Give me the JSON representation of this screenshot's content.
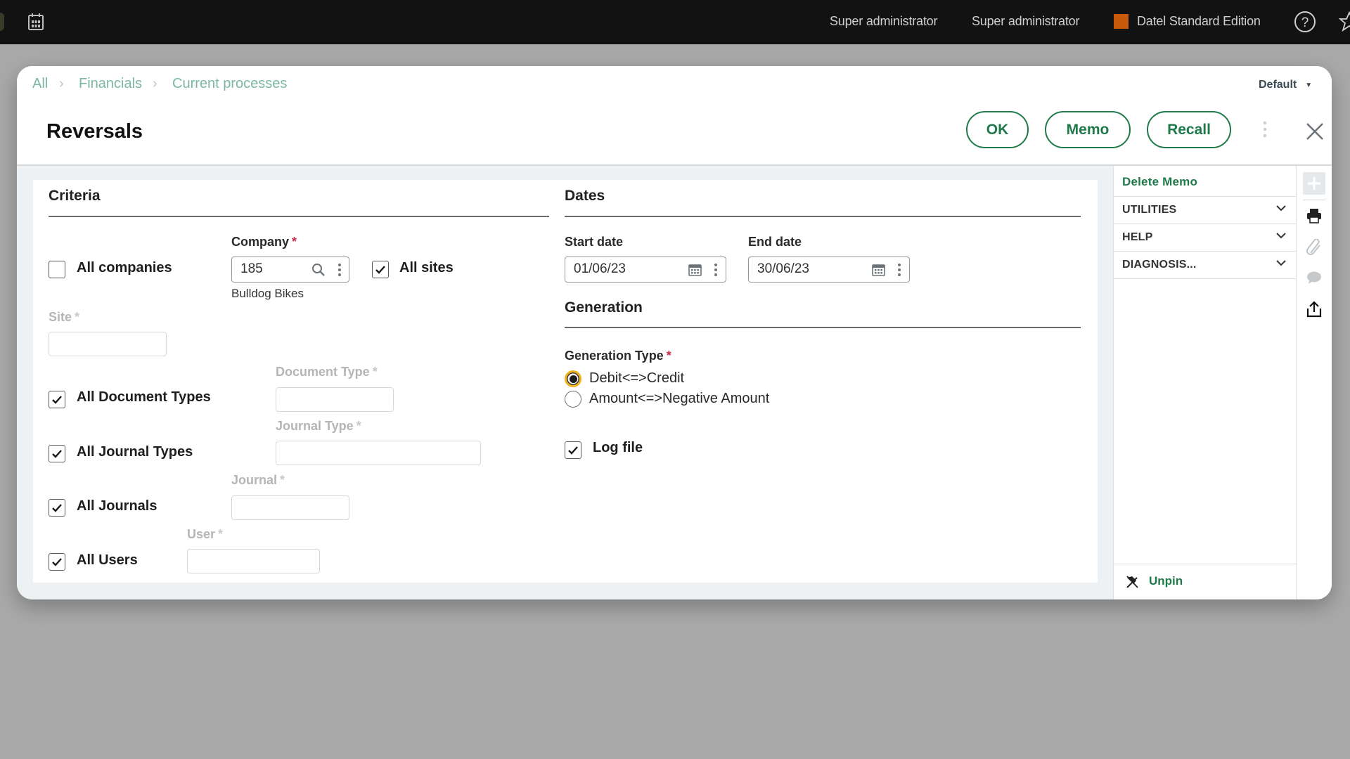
{
  "topbar": {
    "user_1": "Super administrator",
    "user_2": "Super administrator",
    "edition": "Datel Standard Edition",
    "edition_color": "#c95a0c",
    "icons": [
      "calendar-icon",
      "help-icon",
      "star-icon"
    ]
  },
  "breadcrumb": {
    "items": [
      "All",
      "Financials",
      "Current processes"
    ]
  },
  "view_selector": {
    "value": "Default"
  },
  "page": {
    "title": "Reversals"
  },
  "actions": {
    "ok": "OK",
    "memo": "Memo",
    "recall": "Recall"
  },
  "criteria": {
    "title": "Criteria",
    "all_companies": {
      "label": "All companies",
      "checked": false
    },
    "company": {
      "label": "Company",
      "required": "*",
      "value": "185",
      "description": "Bulldog Bikes"
    },
    "all_sites": {
      "label": "All sites",
      "checked": true
    },
    "site": {
      "label": "Site",
      "required": "*",
      "value": ""
    },
    "all_document_types": {
      "label": "All Document Types",
      "checked": true
    },
    "document_type": {
      "label": "Document Type",
      "required": "*",
      "value": ""
    },
    "all_journal_types": {
      "label": "All Journal Types",
      "checked": true
    },
    "journal_type": {
      "label": "Journal Type",
      "required": "*",
      "value": ""
    },
    "all_journals": {
      "label": "All Journals",
      "checked": true
    },
    "journal": {
      "label": "Journal",
      "required": "*",
      "value": ""
    },
    "all_users": {
      "label": "All Users",
      "checked": true
    },
    "user": {
      "label": "User",
      "required": "*",
      "value": ""
    }
  },
  "dates": {
    "title": "Dates",
    "start_date": {
      "label": "Start date",
      "value": "01/06/23"
    },
    "end_date": {
      "label": "End date",
      "value": "30/06/23"
    }
  },
  "generation": {
    "title": "Generation",
    "type_label": "Generation Type",
    "required": "*",
    "options": [
      {
        "label": "Debit<=>Credit",
        "selected": true
      },
      {
        "label": "Amount<=>Negative Amount",
        "selected": false
      }
    ],
    "log_file": {
      "label": "Log file",
      "checked": true
    }
  },
  "sidebar": {
    "delete_memo": "Delete Memo",
    "sections": [
      "UTILITIES",
      "HELP",
      "DIAGNOSIS..."
    ],
    "unpin": "Unpin",
    "accent_color": "#1f7a4a"
  },
  "icon_column": [
    "plus-icon",
    "print-icon",
    "attachment-icon",
    "comment-icon",
    "export-icon"
  ]
}
